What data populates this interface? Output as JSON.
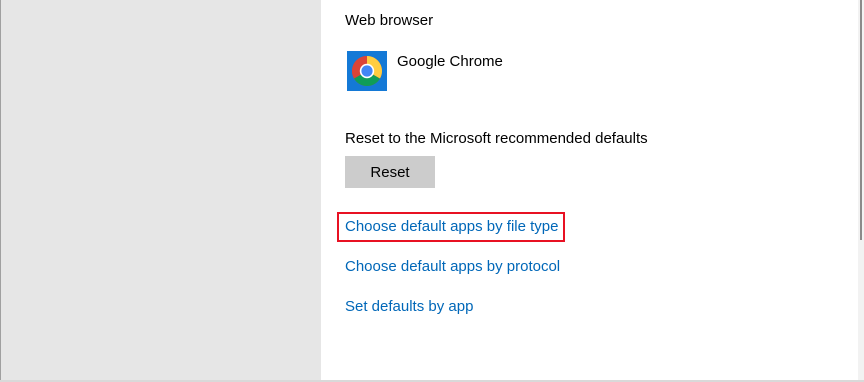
{
  "default_apps": {
    "web_browser": {
      "label": "Web browser",
      "app_name": "Google Chrome",
      "app_icon": "chrome-icon"
    },
    "reset": {
      "label": "Reset to the Microsoft recommended defaults",
      "button_label": "Reset"
    },
    "links": [
      {
        "label": "Choose default apps by file type",
        "highlighted": true
      },
      {
        "label": "Choose default apps by protocol",
        "highlighted": false
      },
      {
        "label": "Set defaults by app",
        "highlighted": false
      }
    ]
  },
  "colors": {
    "link": "#0067b8",
    "highlight_border": "#e81123",
    "sidebar_bg": "#e6e6e6",
    "button_bg": "#cccccc",
    "icon_tile_bg": "#1479d6"
  }
}
